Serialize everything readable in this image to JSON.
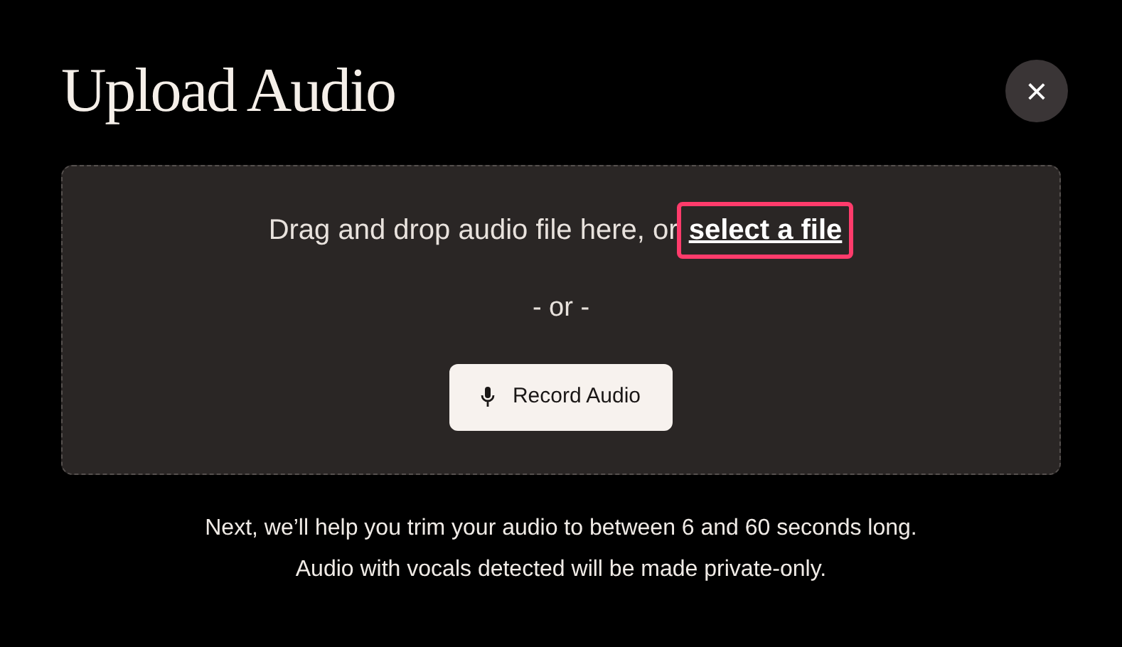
{
  "dialog": {
    "title": "Upload Audio",
    "close": "×"
  },
  "dropzone": {
    "instruction": "Drag and drop audio file here, or",
    "link": {
      "label": "select a file",
      "highlighted": true
    },
    "separator": "- or -",
    "record_button": "Record Audio"
  },
  "notes": [
    "Next, we’ll help you trim your audio to between 6 and 60 seconds long.",
    "Audio with vocals detected will be made private-only."
  ]
}
